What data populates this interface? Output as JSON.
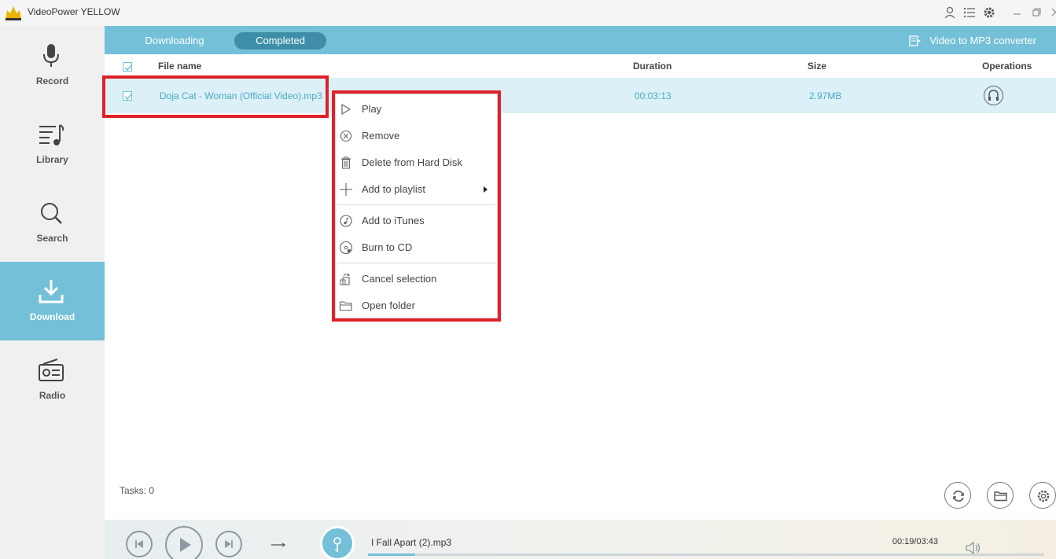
{
  "app": {
    "title": "VideoPower YELLOW",
    "accent": "#73c0d8",
    "highlight": "#e0202a"
  },
  "titlebar_icons": [
    "user-icon",
    "list-icon",
    "settings-icon",
    "minimize-icon",
    "restore-icon",
    "close-icon"
  ],
  "sidebar": {
    "items": [
      {
        "label": "Record",
        "icon": "microphone-icon",
        "active": false
      },
      {
        "label": "Library",
        "icon": "music-list-icon",
        "active": false
      },
      {
        "label": "Search",
        "icon": "search-icon",
        "active": false
      },
      {
        "label": "Download",
        "icon": "download-icon",
        "active": true
      },
      {
        "label": "Radio",
        "icon": "radio-icon",
        "active": false
      }
    ]
  },
  "tabs": [
    {
      "label": "Downloading",
      "active": false
    },
    {
      "label": "Completed",
      "active": true
    }
  ],
  "converter_label": "Video to MP3 converter",
  "table": {
    "headers": {
      "file_name": "File name",
      "duration": "Duration",
      "size": "Size",
      "operations": "Operations"
    },
    "rows": [
      {
        "file_name": "Doja Cat - Woman (Official Video).mp3",
        "duration": "00:03:13",
        "size": "2.97MB",
        "checked": true
      }
    ]
  },
  "context_menu": {
    "items": [
      {
        "label": "Play",
        "icon": "play-icon"
      },
      {
        "label": "Remove",
        "icon": "remove-circle-icon"
      },
      {
        "label": "Delete from Hard Disk",
        "icon": "trash-icon"
      },
      {
        "label": "Add to playlist",
        "icon": "plus-icon",
        "submenu": true
      },
      {
        "label": "Add to iTunes",
        "icon": "itunes-icon"
      },
      {
        "label": "Burn to CD",
        "icon": "cd-icon"
      },
      {
        "label": "Cancel selection",
        "icon": "cancel-selection-icon"
      },
      {
        "label": "Open folder",
        "icon": "folder-icon"
      }
    ]
  },
  "footer": {
    "tasks": "Tasks: 0"
  },
  "player": {
    "track": "I Fall Apart (2).mp3",
    "time": "00:19/03:43",
    "progress": 0.07
  }
}
